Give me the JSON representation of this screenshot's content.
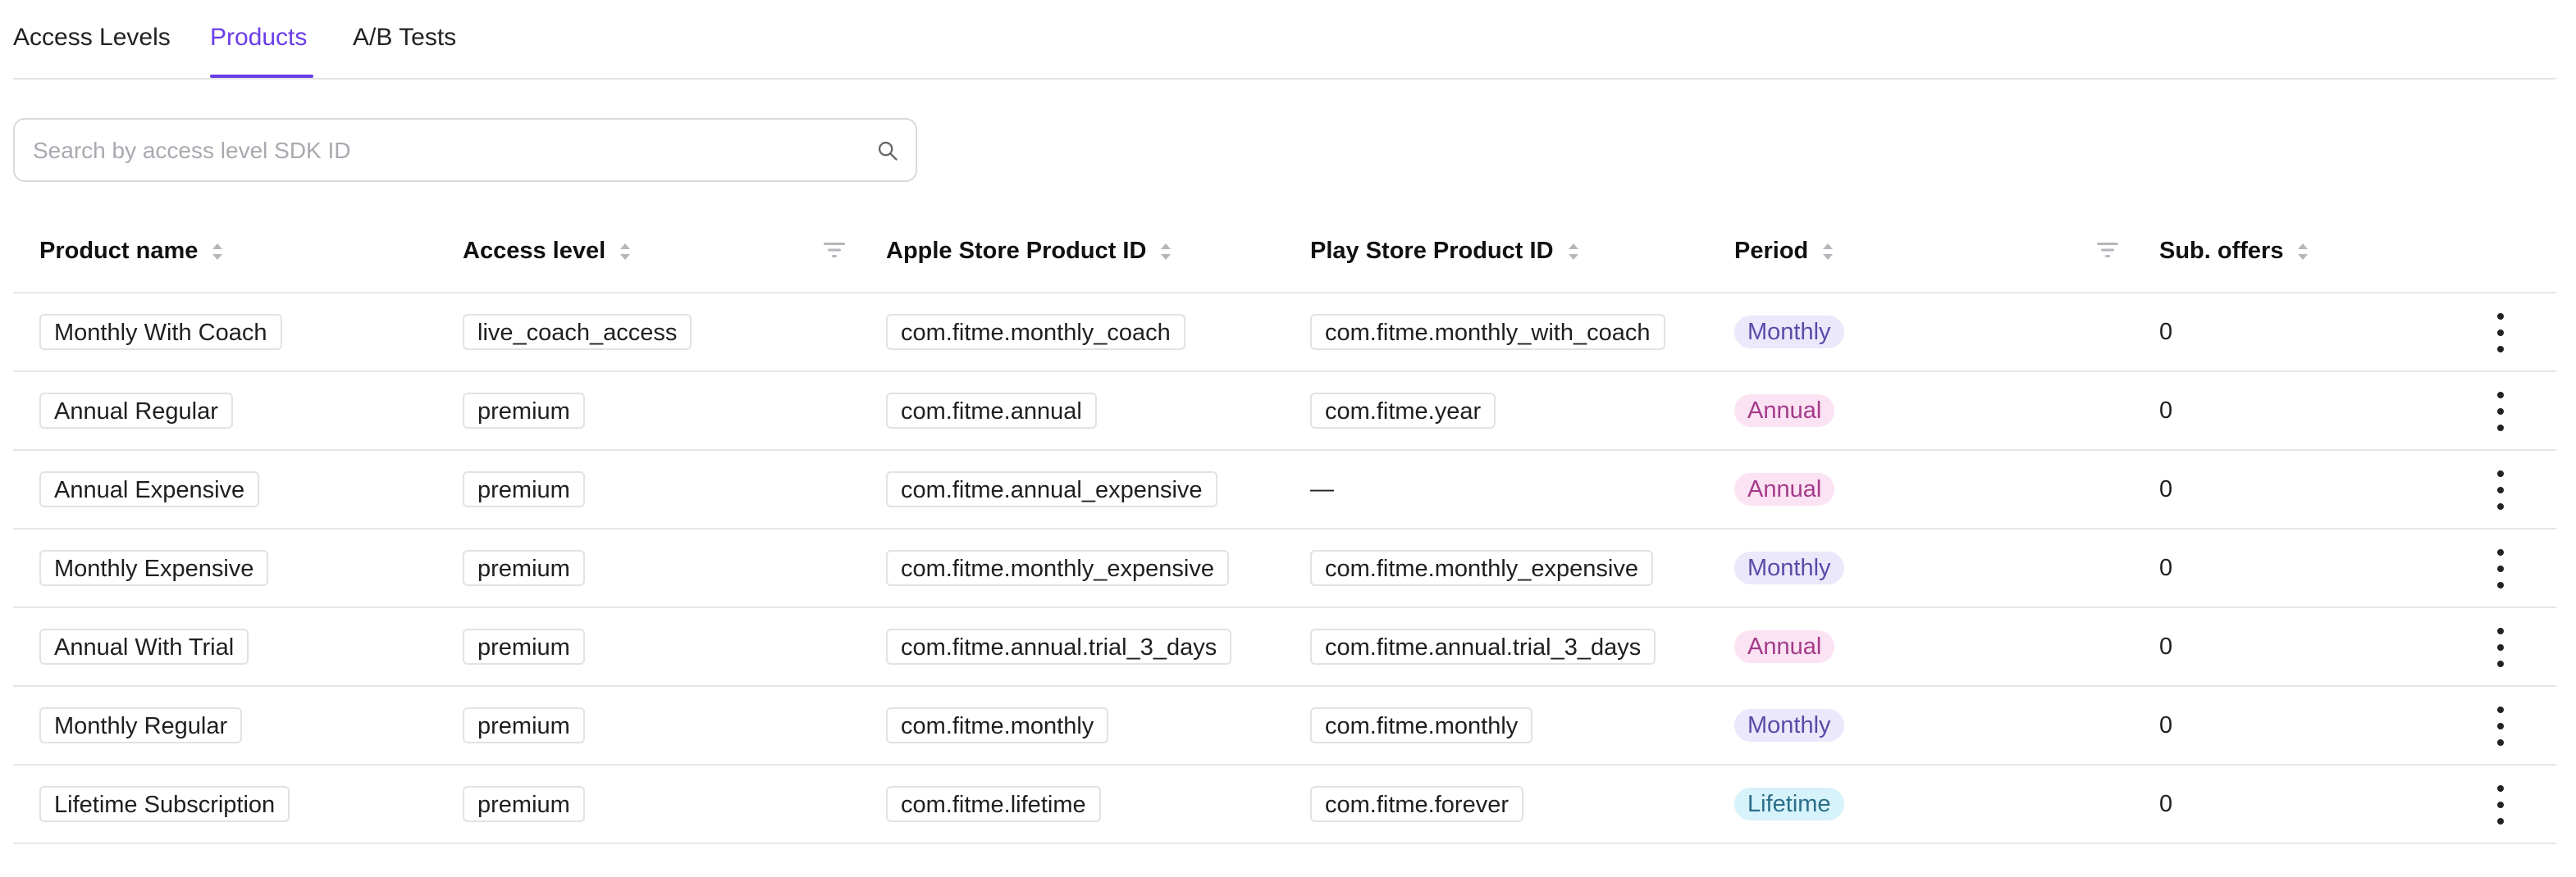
{
  "tabs": [
    {
      "label": "Access Levels",
      "active": false
    },
    {
      "label": "Products",
      "active": true
    },
    {
      "label": "A/B Tests",
      "active": false
    }
  ],
  "search": {
    "placeholder": "Search by access level SDK ID",
    "value": "",
    "icon": "search-icon"
  },
  "table": {
    "headers": {
      "product_name": "Product name",
      "access_level": "Access level",
      "apple_id": "Apple Store Product ID",
      "play_id": "Play Store Product ID",
      "period": "Period",
      "sub_offers": "Sub. offers"
    },
    "rows": [
      {
        "product_name": "Monthly With Coach",
        "access_level": "live_coach_access",
        "apple_id": "com.fitme.monthly_coach",
        "play_id": "com.fitme.monthly_with_coach",
        "period": "Monthly",
        "sub_offers": "0"
      },
      {
        "product_name": "Annual Regular",
        "access_level": "premium",
        "apple_id": "com.fitme.annual",
        "play_id": "com.fitme.year",
        "period": "Annual",
        "sub_offers": "0"
      },
      {
        "product_name": "Annual Expensive",
        "access_level": "premium",
        "apple_id": "com.fitme.annual_expensive",
        "play_id": "—",
        "period": "Annual",
        "sub_offers": "0"
      },
      {
        "product_name": "Monthly Expensive",
        "access_level": "premium",
        "apple_id": "com.fitme.monthly_expensive",
        "play_id": "com.fitme.monthly_expensive",
        "period": "Monthly",
        "sub_offers": "0"
      },
      {
        "product_name": "Annual With Trial",
        "access_level": "premium",
        "apple_id": "com.fitme.annual.trial_3_days",
        "play_id": "com.fitme.annual.trial_3_days",
        "period": "Annual",
        "sub_offers": "0"
      },
      {
        "product_name": "Monthly Regular",
        "access_level": "premium",
        "apple_id": "com.fitme.monthly",
        "play_id": "com.fitme.monthly",
        "period": "Monthly",
        "sub_offers": "0"
      },
      {
        "product_name": "Lifetime Subscription",
        "access_level": "premium",
        "apple_id": "com.fitme.lifetime",
        "play_id": "com.fitme.forever",
        "period": "Lifetime",
        "sub_offers": "0"
      }
    ]
  },
  "colors": {
    "accent": "#6b3dea",
    "monthly_bg": "#ebe8fb",
    "annual_bg": "#fbe3f3",
    "lifetime_bg": "#d6f2fb"
  }
}
